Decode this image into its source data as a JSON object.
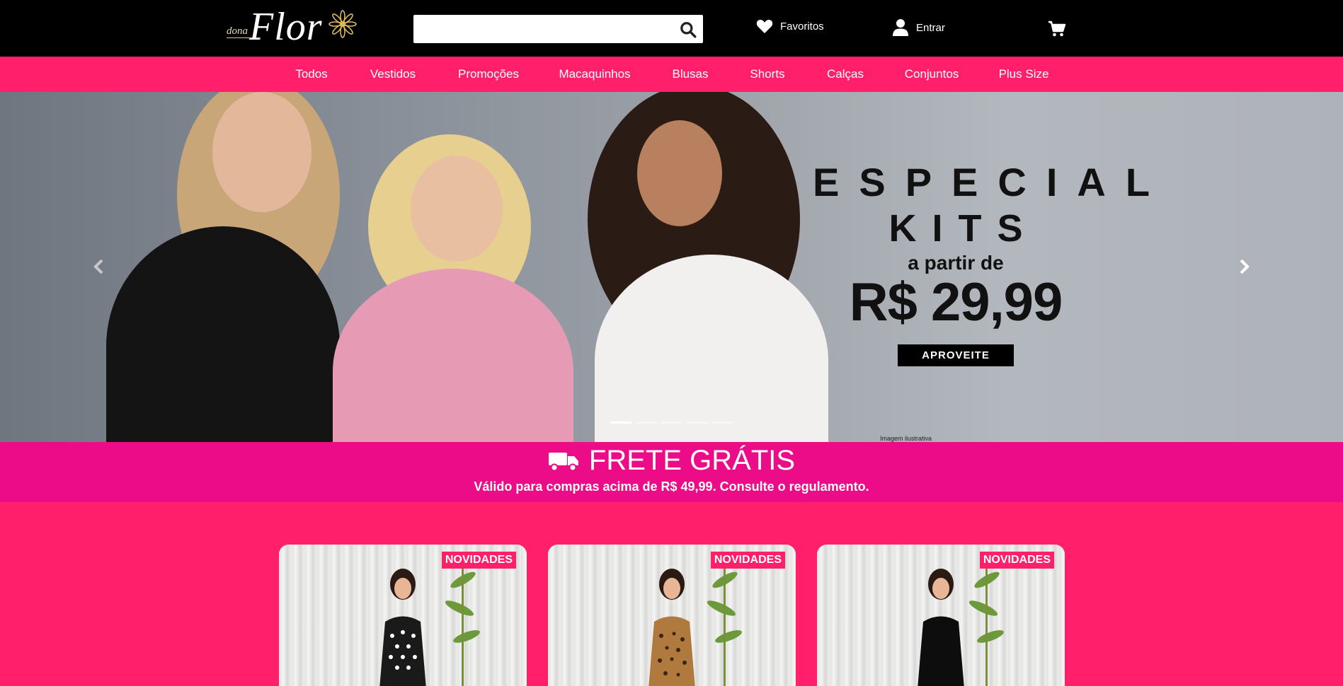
{
  "brand": {
    "prefix": "dona",
    "name": "Flor"
  },
  "search": {
    "placeholder": ""
  },
  "header": {
    "favorites_label": "Favoritos",
    "login_label": "Entrar"
  },
  "nav": {
    "items": [
      "Todos",
      "Vestidos",
      "Promoções",
      "Macaquinhos",
      "Blusas",
      "Shorts",
      "Calças",
      "Conjuntos",
      "Plus Size"
    ]
  },
  "hero": {
    "line1": "ESPECIAL",
    "line2": "KITS",
    "line3": "a partir de",
    "price": "R$ 29,99",
    "cta": "APROVEITE",
    "note": "Imagem ilustrativa",
    "slides": 5,
    "active_slide": 1
  },
  "shipping": {
    "title": "FRETE GRÁTIS",
    "subtitle": "Válido para compras acima de R$ 49,99. Consulte o regulamento."
  },
  "products": [
    {
      "badge": "NOVIDADES",
      "dress": "polka-dot"
    },
    {
      "badge": "NOVIDADES",
      "dress": "leopard"
    },
    {
      "badge": "NOVIDADES",
      "dress": "black"
    }
  ],
  "colors": {
    "header_bg": "#000000",
    "nav_bg": "#ff1f6b",
    "shipping_bg": "#ec0c88",
    "badge_bg": "#ff1f6b"
  }
}
